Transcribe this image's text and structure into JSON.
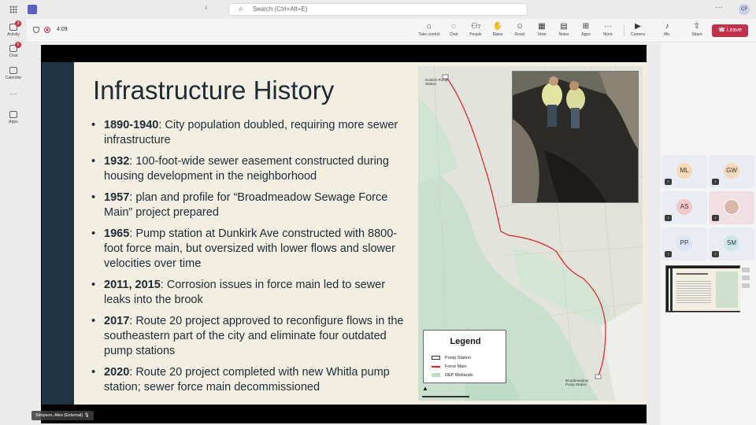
{
  "titlebar": {
    "search_placeholder": "Search (Ctrl+Alt+E)",
    "avatar_initials": "CF",
    "more_label": "···"
  },
  "rail": [
    {
      "label": "Activity",
      "badge": "3"
    },
    {
      "label": "Chat",
      "badge": "5"
    },
    {
      "label": "Calendar",
      "badge": ""
    },
    {
      "label": "Apps",
      "badge": ""
    }
  ],
  "meeting": {
    "timer": "4:09",
    "tools": [
      {
        "label": "Take control",
        "icon": "⌂"
      },
      {
        "label": "Chat",
        "icon": "◌"
      },
      {
        "label": "People",
        "icon": "⚇"
      },
      {
        "label": "Raise",
        "icon": "✋"
      },
      {
        "label": "React",
        "icon": "☺"
      },
      {
        "label": "View",
        "icon": "▦"
      },
      {
        "label": "Notes",
        "icon": "▤"
      },
      {
        "label": "Apps",
        "icon": "⊞"
      },
      {
        "label": "More",
        "icon": "···"
      },
      {
        "label": "Camera",
        "icon": "▶"
      },
      {
        "label": "Mic",
        "icon": "♪"
      },
      {
        "label": "Share",
        "icon": "⇧"
      }
    ],
    "people_count": "7",
    "leave_label": "Leave"
  },
  "slide": {
    "title": "Infrastructure History",
    "bullets": [
      {
        "year": "1890-1940",
        "text": ": City population doubled, requiring more sewer infrastructure"
      },
      {
        "year": "1932",
        "text": ": 100-foot-wide sewer easement constructed during housing development in the neighborhood"
      },
      {
        "year": "1957",
        "text": ": plan and profile for “Broadmeadow Sewage Force Main” project prepared"
      },
      {
        "year": "1965",
        "text": ": Pump station at Dunkirk Ave constructed with 8800-foot force main, but oversized with lower flows and slower velocities over time"
      },
      {
        "year": "2011, 2015",
        "text": ": Corrosion issues in force main led to sewer leaks into the brook"
      },
      {
        "year": "2017",
        "text": ": Route 20 project approved to reconfigure flows in the southeastern part of the city and eliminate four outdated pump stations"
      },
      {
        "year": "2020",
        "text": ": Route 20 project completed with new Whitla pump station; sewer force main decommissioned"
      }
    ],
    "map": {
      "label_top": "Dunkirk Pump Station",
      "label_bottom": "Broadmeadow Pump Station",
      "legend_title": "Legend",
      "legend_items": [
        {
          "label": "Pump Station",
          "color": "#ffffff"
        },
        {
          "label": "Force Main",
          "color": "#e02020"
        },
        {
          "label": "DEP Wetlands",
          "color": "#b9dcc4"
        }
      ]
    }
  },
  "presenter": {
    "name": "Simpson, Alex (External)"
  },
  "participants": [
    {
      "initials": "ML",
      "color": "#f5d9b8"
    },
    {
      "initials": "GW",
      "color": "#f5d9b8"
    },
    {
      "initials": "AS",
      "color": "#f7c6cc"
    },
    {
      "initials": "",
      "color": "#d9b8a8"
    },
    {
      "initials": "PP",
      "color": "#dfe6f3"
    },
    {
      "initials": "SM",
      "color": "#cfe6ea"
    }
  ]
}
